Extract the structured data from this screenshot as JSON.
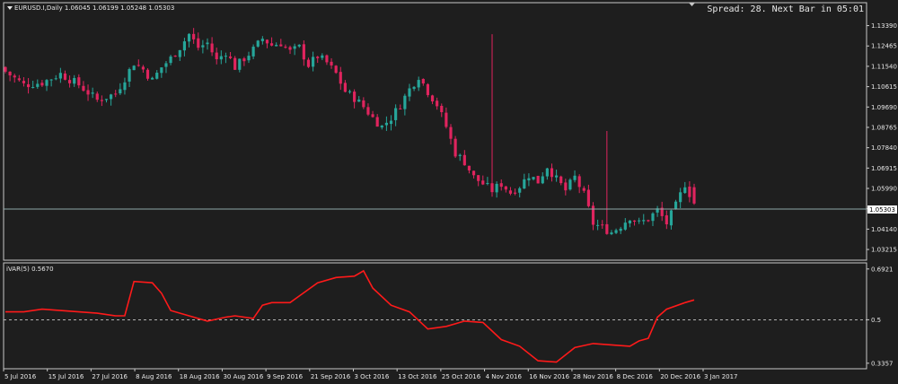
{
  "price_pane": {
    "title": "EURUSD.I,Daily  1.06045 1.06199 1.05248 1.05303",
    "status": "Spread: 28. Next Bar in 05:01",
    "current_price_label": "1.05303"
  },
  "indicator_pane": {
    "title": "iVAR(5) 0.5670"
  },
  "colors": {
    "background": "#1e1e1e",
    "bull": "#26a69a",
    "bear": "#e0245e",
    "indicator": "#ff1a1a",
    "grid_border": "#c8c8c8",
    "price_line": "#8fa8a8",
    "price_box_bg": "#ffffff"
  },
  "chart_data": [
    {
      "type": "candlestick",
      "symbol": "EURUSD.I",
      "timeframe": "Daily",
      "ohlc_last": {
        "open": 1.06045,
        "high": 1.06199,
        "low": 1.05248,
        "close": 1.05303
      },
      "ylim": [
        1.0285,
        1.1431
      ],
      "ytick_labels": [
        "1.13390",
        "1.12465",
        "1.11540",
        "1.10615",
        "1.09690",
        "1.08765",
        "1.07840",
        "1.06915",
        "1.05990",
        "1.05065",
        "1.04140",
        "1.03215"
      ],
      "xtick_labels": [
        "5 Jul 2016",
        "15 Jul 2016",
        "27 Jul 2016",
        "8 Aug 2016",
        "18 Aug 2016",
        "30 Aug 2016",
        "9 Sep 2016",
        "21 Sep 2016",
        "3 Oct 2016",
        "13 Oct 2016",
        "25 Oct 2016",
        "4 Nov 2016",
        "16 Nov 2016",
        "28 Nov 2016",
        "8 Dec 2016",
        "20 Dec 2016",
        "3 Jan 2017"
      ],
      "close_path": [
        [
          0,
          1.113
        ],
        [
          4,
          1.107
        ],
        [
          8,
          1.108
        ],
        [
          12,
          1.112
        ],
        [
          16,
          1.107
        ],
        [
          20,
          1.1
        ],
        [
          24,
          1.103
        ],
        [
          28,
          1.117
        ],
        [
          30,
          1.114
        ],
        [
          32,
          1.109
        ],
        [
          34,
          1.115
        ],
        [
          36,
          1.119
        ],
        [
          38,
          1.124
        ],
        [
          40,
          1.13
        ],
        [
          42,
          1.124
        ],
        [
          44,
          1.126
        ],
        [
          46,
          1.118
        ],
        [
          48,
          1.122
        ],
        [
          50,
          1.115
        ],
        [
          52,
          1.119
        ],
        [
          54,
          1.123
        ],
        [
          56,
          1.128
        ],
        [
          58,
          1.125
        ],
        [
          60,
          1.126
        ],
        [
          62,
          1.122
        ],
        [
          64,
          1.124
        ],
        [
          66,
          1.116
        ],
        [
          68,
          1.12
        ],
        [
          70,
          1.117
        ],
        [
          72,
          1.112
        ],
        [
          74,
          1.104
        ],
        [
          76,
          1.101
        ],
        [
          78,
          1.097
        ],
        [
          80,
          1.092
        ],
        [
          82,
          1.088
        ],
        [
          84,
          1.092
        ],
        [
          86,
          1.098
        ],
        [
          88,
          1.105
        ],
        [
          90,
          1.111
        ],
        [
          92,
          1.104
        ],
        [
          94,
          1.098
        ],
        [
          96,
          1.088
        ],
        [
          98,
          1.076
        ],
        [
          100,
          1.072
        ],
        [
          102,
          1.065
        ],
        [
          104,
          1.062
        ],
        [
          106,
          1.059
        ],
        [
          108,
          1.062
        ],
        [
          110,
          1.058
        ],
        [
          112,
          1.061
        ],
        [
          114,
          1.066
        ],
        [
          116,
          1.063
        ],
        [
          118,
          1.07
        ],
        [
          120,
          1.064
        ],
        [
          122,
          1.059
        ],
        [
          124,
          1.065
        ],
        [
          126,
          1.057
        ],
        [
          128,
          1.044
        ],
        [
          130,
          1.042
        ],
        [
          132,
          1.04
        ],
        [
          134,
          1.043
        ],
        [
          136,
          1.047
        ],
        [
          138,
          1.044
        ],
        [
          140,
          1.046
        ],
        [
          142,
          1.05
        ],
        [
          144,
          1.044
        ],
        [
          146,
          1.052
        ],
        [
          148,
          1.062
        ],
        [
          150,
          1.053
        ]
      ]
    },
    {
      "type": "line",
      "name": "iVAR(5)",
      "last_value": 0.567,
      "ylim": [
        0.325,
        0.705
      ],
      "ytick_labels": [
        "0.6921",
        "0.5",
        "0.3357"
      ],
      "reference_level": 0.5,
      "x": [
        0,
        4,
        8,
        12,
        16,
        20,
        24,
        26,
        28,
        32,
        34,
        36,
        40,
        44,
        48,
        50,
        54,
        56,
        58,
        62,
        64,
        68,
        72,
        76,
        78,
        80,
        84,
        88,
        92,
        96,
        100,
        104,
        108,
        112,
        116,
        120,
        124,
        128,
        132,
        136,
        138,
        140,
        142,
        144,
        148,
        150
      ],
      "values": [
        0.53,
        0.53,
        0.54,
        0.535,
        0.53,
        0.525,
        0.515,
        0.515,
        0.645,
        0.64,
        0.6,
        0.535,
        0.515,
        0.495,
        0.51,
        0.515,
        0.505,
        0.555,
        0.565,
        0.565,
        0.59,
        0.64,
        0.66,
        0.665,
        0.685,
        0.62,
        0.555,
        0.53,
        0.465,
        0.475,
        0.495,
        0.49,
        0.425,
        0.4,
        0.345,
        0.34,
        0.395,
        0.41,
        0.405,
        0.4,
        0.42,
        0.43,
        0.51,
        0.54,
        0.565,
        0.575
      ]
    }
  ]
}
